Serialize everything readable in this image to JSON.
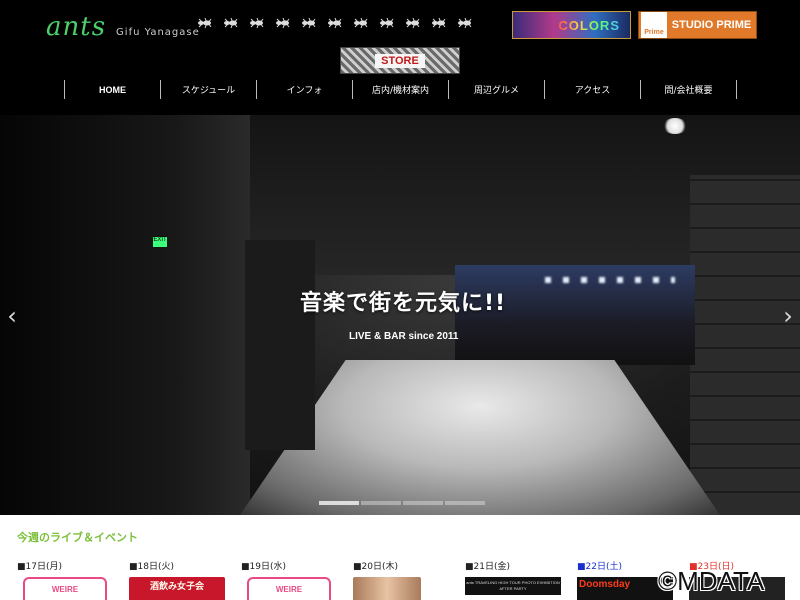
{
  "header": {
    "logo_main": "ants",
    "logo_sub": "Gifu Yanagase",
    "banners": {
      "colors": "COLORS",
      "prime_mark": "Prime",
      "studio_prime": "STUDIO PRIME",
      "store": "STORE"
    }
  },
  "nav": {
    "items": [
      {
        "label": "HOME"
      },
      {
        "label": "スケジュール"
      },
      {
        "label": "インフォ"
      },
      {
        "label": "店内/機材案内"
      },
      {
        "label": "周辺グルメ"
      },
      {
        "label": "アクセス"
      },
      {
        "label": "問/会社概要"
      }
    ]
  },
  "hero": {
    "title": "音楽で街を元気に!!",
    "subtitle": "LIVE & BAR since 2011",
    "exit_sign": "EXIT",
    "prev": "‹",
    "next": "›",
    "slide_count": 4,
    "active_slide": 1
  },
  "schedule": {
    "title": "今週のライブ＆イベント",
    "days": [
      {
        "label": "■17日(月)",
        "color": "#222222",
        "flyer": "WEIRE"
      },
      {
        "label": "■18日(火)",
        "color": "#222222",
        "flyer": "酒飲み女子会"
      },
      {
        "label": "■19日(水)",
        "color": "#222222",
        "flyer": "WEIRE"
      },
      {
        "label": "■20日(木)",
        "color": "#222222",
        "flyer": ""
      },
      {
        "label": "■21日(金)",
        "color": "#222222",
        "flyer": "ants TRAVELING HIGH TOUR PHOTO EXHIBITION AFTER PARTY"
      },
      {
        "label": "■22日(土)",
        "color": "#1a2fd0",
        "flyer": "Doomsday"
      },
      {
        "label": "■23日(日)",
        "color": "#e2322b",
        "flyer": ""
      }
    ]
  },
  "watermark": "©MDATA",
  "colors": {
    "accent_green": "#7bbf3a",
    "logo_green": "#4bd06a",
    "saturday_blue": "#1a2fd0",
    "sunday_red": "#e2322b"
  }
}
